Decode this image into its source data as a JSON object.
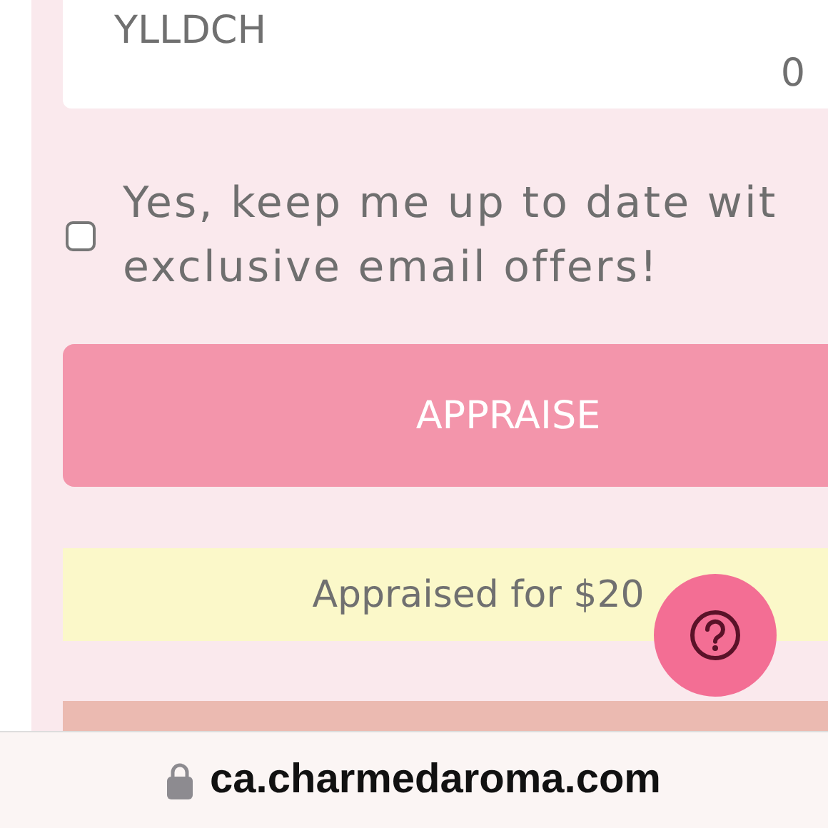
{
  "code_card": {
    "code": "YLLDCH",
    "count": "0"
  },
  "newsletter": {
    "checked": false,
    "lines": [
      "Yes, keep me up to date wit",
      "exclusive email offers!"
    ]
  },
  "appraise_button": "APPRAISE",
  "result": "Appraised for $20",
  "help_button": {
    "kind": "question"
  },
  "address_bar": {
    "url": "ca.charmedaroma.com"
  }
}
